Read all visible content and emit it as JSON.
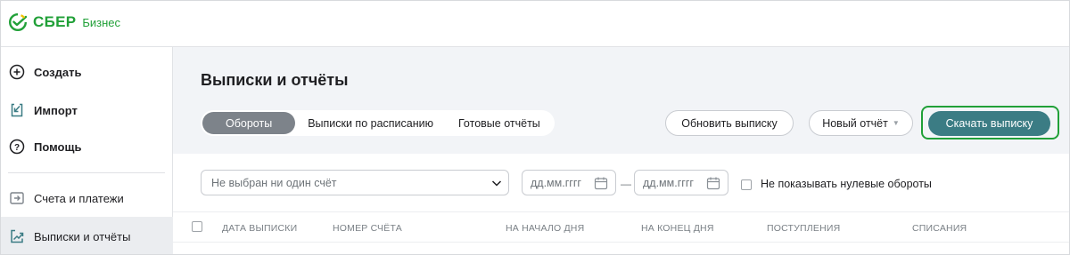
{
  "header": {
    "brand": "СБЕР",
    "product": "Бизнес",
    "brand_color": "#21a038",
    "logo_icon": "sber-logo-icon"
  },
  "sidebar": {
    "items": [
      {
        "label": "Создать",
        "icon": "plus-circle-icon",
        "bold": true,
        "active": false
      },
      {
        "label": "Импорт",
        "icon": "import-icon",
        "bold": true,
        "active": false
      },
      {
        "label": "Помощь",
        "icon": "help-circle-icon",
        "bold": true,
        "active": false
      },
      {
        "label": "Счета и платежи",
        "icon": "accounts-icon",
        "bold": false,
        "active": false
      },
      {
        "label": "Выписки и отчёты",
        "icon": "statements-icon",
        "bold": false,
        "active": true
      }
    ]
  },
  "main": {
    "title": "Выписки и отчёты",
    "tabs": [
      {
        "label": "Обороты",
        "active": true
      },
      {
        "label": "Выписки по расписанию",
        "active": false
      },
      {
        "label": "Готовые отчёты",
        "active": false
      }
    ],
    "refresh_button": "Обновить выписку",
    "new_report_button": "Новый отчёт",
    "download_button": "Скачать выписку",
    "accent_color": "#3b7c84",
    "highlight_color": "#21a038"
  },
  "filters": {
    "account_select_placeholder": "Не выбран ни один счёт",
    "date_from_placeholder": "дд.мм.гггг",
    "date_separator": "—",
    "date_to_placeholder": "дд.мм.гггг",
    "hide_zero_label": "Не показывать нулевые обороты",
    "hide_zero_checked": false
  },
  "table": {
    "columns": [
      "ДАТА ВЫПИСКИ",
      "НОМЕР СЧЁТА",
      "НА НАЧАЛО ДНЯ",
      "НА КОНЕЦ ДНЯ",
      "ПОСТУПЛЕНИЯ",
      "СПИСАНИЯ"
    ]
  }
}
